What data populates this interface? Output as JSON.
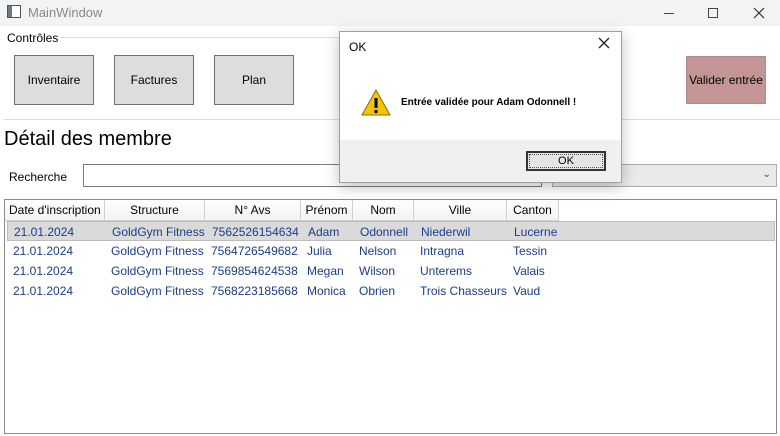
{
  "window": {
    "title": "MainWindow"
  },
  "controls": {
    "group_label": "Contrôles",
    "inventory": "Inventaire",
    "invoices": "Factures",
    "plan": "Plan",
    "validate": "Valider entrée"
  },
  "main": {
    "section_title": "Détail des membre",
    "search_label": "Recherche",
    "search_value": "",
    "combo_value": ""
  },
  "grid": {
    "columns": [
      "Date d'inscription",
      "Structure",
      "N° Avs",
      "Prénom",
      "Nom",
      "Ville",
      "Canton"
    ],
    "rows": [
      [
        "21.01.2024",
        "GoldGym Fitness",
        "7562526154634",
        "Adam",
        "Odonnell",
        "Niederwil",
        "Lucerne"
      ],
      [
        "21.01.2024",
        "GoldGym Fitness",
        "7564726549682",
        "Julia",
        "Nelson",
        "Intragna",
        "Tessin"
      ],
      [
        "21.01.2024",
        "GoldGym Fitness",
        "7569854624538",
        "Megan",
        "Wilson",
        "Unterems",
        "Valais"
      ],
      [
        "21.01.2024",
        "GoldGym Fitness",
        "7568223185668",
        "Monica",
        "Obrien",
        "Trois Chasseurs",
        "Vaud"
      ]
    ],
    "selected_row": 0
  },
  "dialog": {
    "title": "OK",
    "message": "Entrée validée pour Adam Odonnell !",
    "ok_label": "OK",
    "icon": "warning-icon"
  },
  "colors": {
    "validate_button": "#c49595",
    "row_text": "#1b3c8a"
  }
}
